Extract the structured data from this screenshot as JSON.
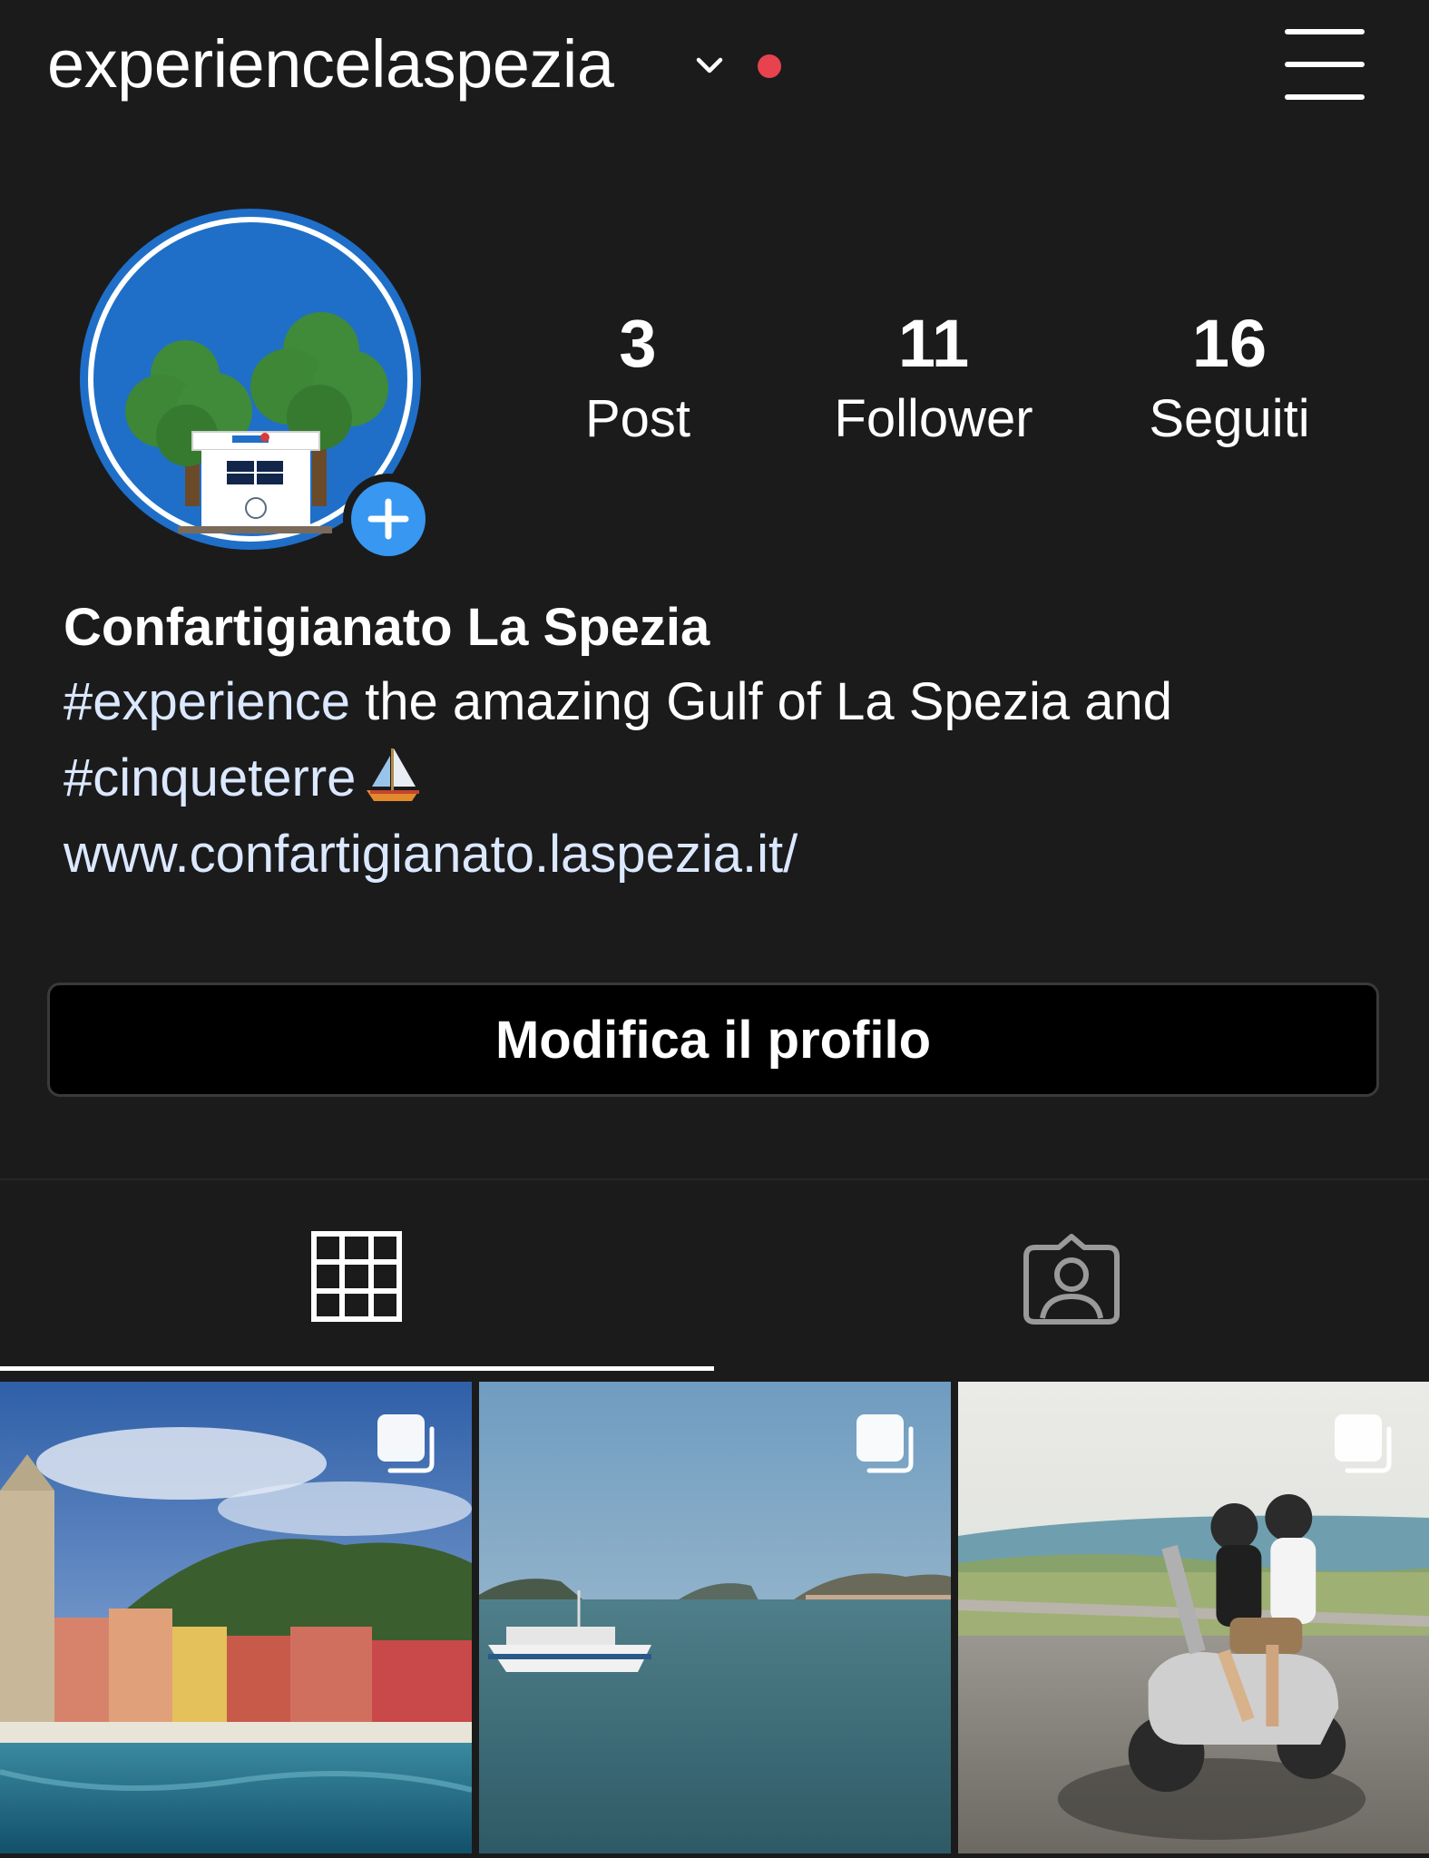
{
  "header": {
    "username": "experiencelaspezia",
    "notification_dot_color": "#e8424f",
    "icons": [
      "chevron-down-icon",
      "menu-icon"
    ]
  },
  "profile": {
    "avatar_ring_color": "#1f6fc8",
    "add_story_color": "#3897f0",
    "stats": {
      "posts": {
        "value": "3",
        "label": "Post"
      },
      "followers": {
        "value": "11",
        "label": "Follower"
      },
      "following": {
        "value": "16",
        "label": "Seguiti"
      }
    },
    "display_name": "Confartigianato La Spezia",
    "bio": {
      "hashtag_1": "#experience",
      "line1_rest": " the amazing Gulf of La Spezia and",
      "hashtag_2": "#cinqueterre",
      "emoji": "sailboat",
      "website": "www.confartigianato.laspezia.it/"
    },
    "edit_button_label": "Modifica il profilo"
  },
  "tabs": [
    {
      "name": "grid",
      "icon": "grid-icon",
      "active": true
    },
    {
      "name": "tagged",
      "icon": "tagged-user-icon",
      "active": false
    }
  ],
  "posts": [
    {
      "subject": "colorful harbor village by the sea",
      "multi_image": true
    },
    {
      "subject": "boat on gulf water with distant town",
      "multi_image": true
    },
    {
      "subject": "couple riding a scooter on coastal road",
      "multi_image": true
    }
  ]
}
